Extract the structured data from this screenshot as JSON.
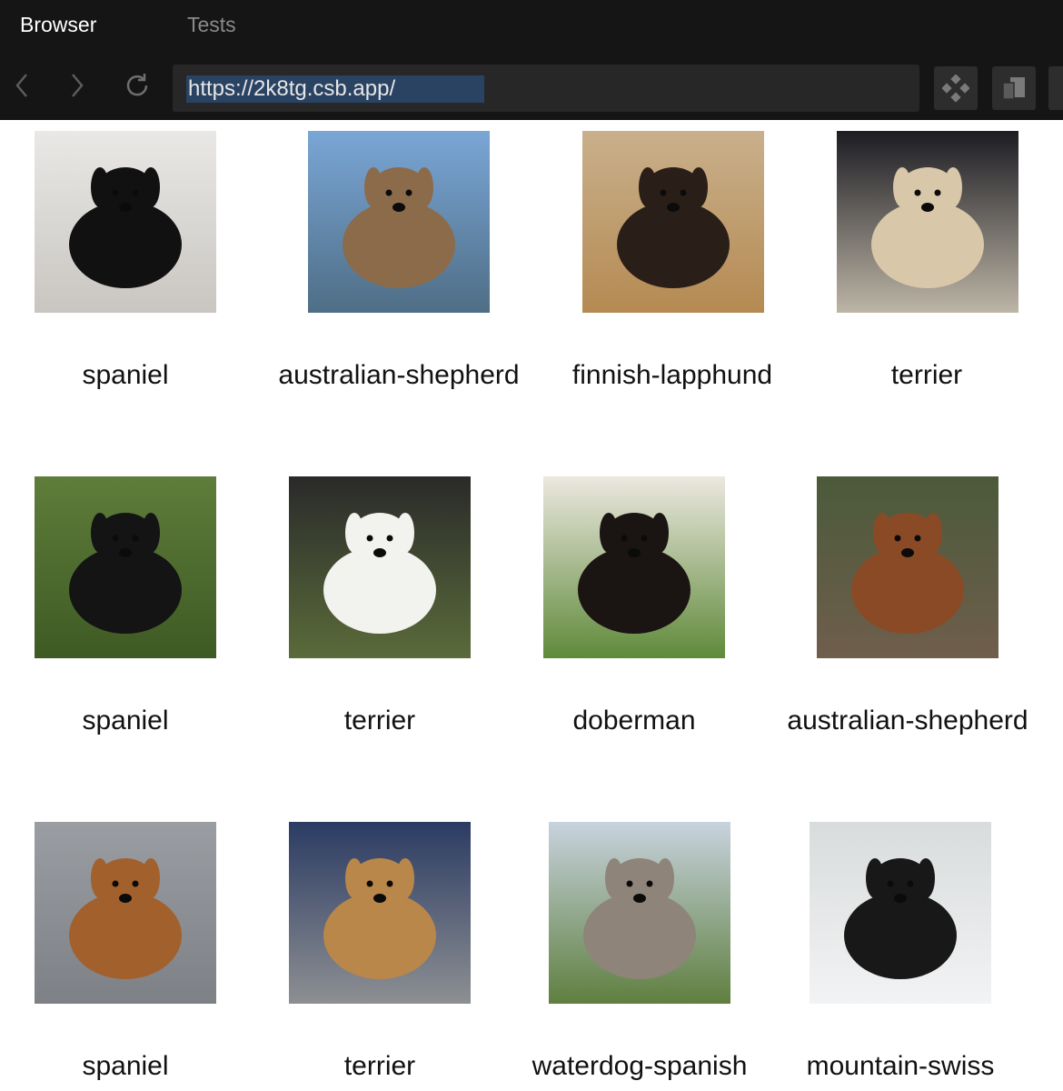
{
  "tabs": [
    {
      "label": "Browser",
      "active": true
    },
    {
      "label": "Tests",
      "active": false
    }
  ],
  "address_bar": {
    "url": "https://2k8tg.csb.app/"
  },
  "icons": {
    "back": "chevron-left-icon",
    "forward": "chevron-right-icon",
    "reload": "reload-icon",
    "devtools": "diamond-grid-icon",
    "split": "copy-panels-icon"
  },
  "colors": {
    "chrome_bg": "#151515",
    "url_bg": "#272727",
    "url_highlight": "#2a4363",
    "active_tab": "#ffffff",
    "inactive_tab": "#8a8a8a"
  },
  "dogs": [
    {
      "breed": "spaniel",
      "scene": [
        "#e9e8e6",
        "#c9c6c1",
        "#111111"
      ]
    },
    {
      "breed": "australian-shepherd",
      "scene": [
        "#7aa6d6",
        "#4f6e86",
        "#8b6b4a"
      ]
    },
    {
      "breed": "finnish-lapphund",
      "scene": [
        "#c9b08c",
        "#b58a52",
        "#2a1f18"
      ]
    },
    {
      "breed": "terrier",
      "scene": [
        "#1c1c22",
        "#bdb5a6",
        "#d8c7a8"
      ]
    },
    {
      "breed": "spaniel",
      "scene": [
        "#5f7d3a",
        "#3e5a24",
        "#141414"
      ]
    },
    {
      "breed": "terrier",
      "scene": [
        "#2a2a2a",
        "#5a6b3a",
        "#f2f2ee"
      ]
    },
    {
      "breed": "doberman",
      "scene": [
        "#ece8e0",
        "#5f8a3a",
        "#1a1412"
      ]
    },
    {
      "breed": "australian-shepherd",
      "scene": [
        "#4b5a3a",
        "#6f5e4c",
        "#8a4a26"
      ]
    },
    {
      "breed": "spaniel",
      "scene": [
        "#9a9ea3",
        "#7d8186",
        "#a2602d"
      ]
    },
    {
      "breed": "terrier",
      "scene": [
        "#2b3b63",
        "#8d8f92",
        "#b9874a"
      ]
    },
    {
      "breed": "waterdog-spanish",
      "scene": [
        "#c8d3de",
        "#5f7f3f",
        "#8e847a"
      ]
    },
    {
      "breed": "mountain-swiss",
      "scene": [
        "#d9dcdc",
        "#f2f3f4",
        "#181818"
      ]
    }
  ]
}
